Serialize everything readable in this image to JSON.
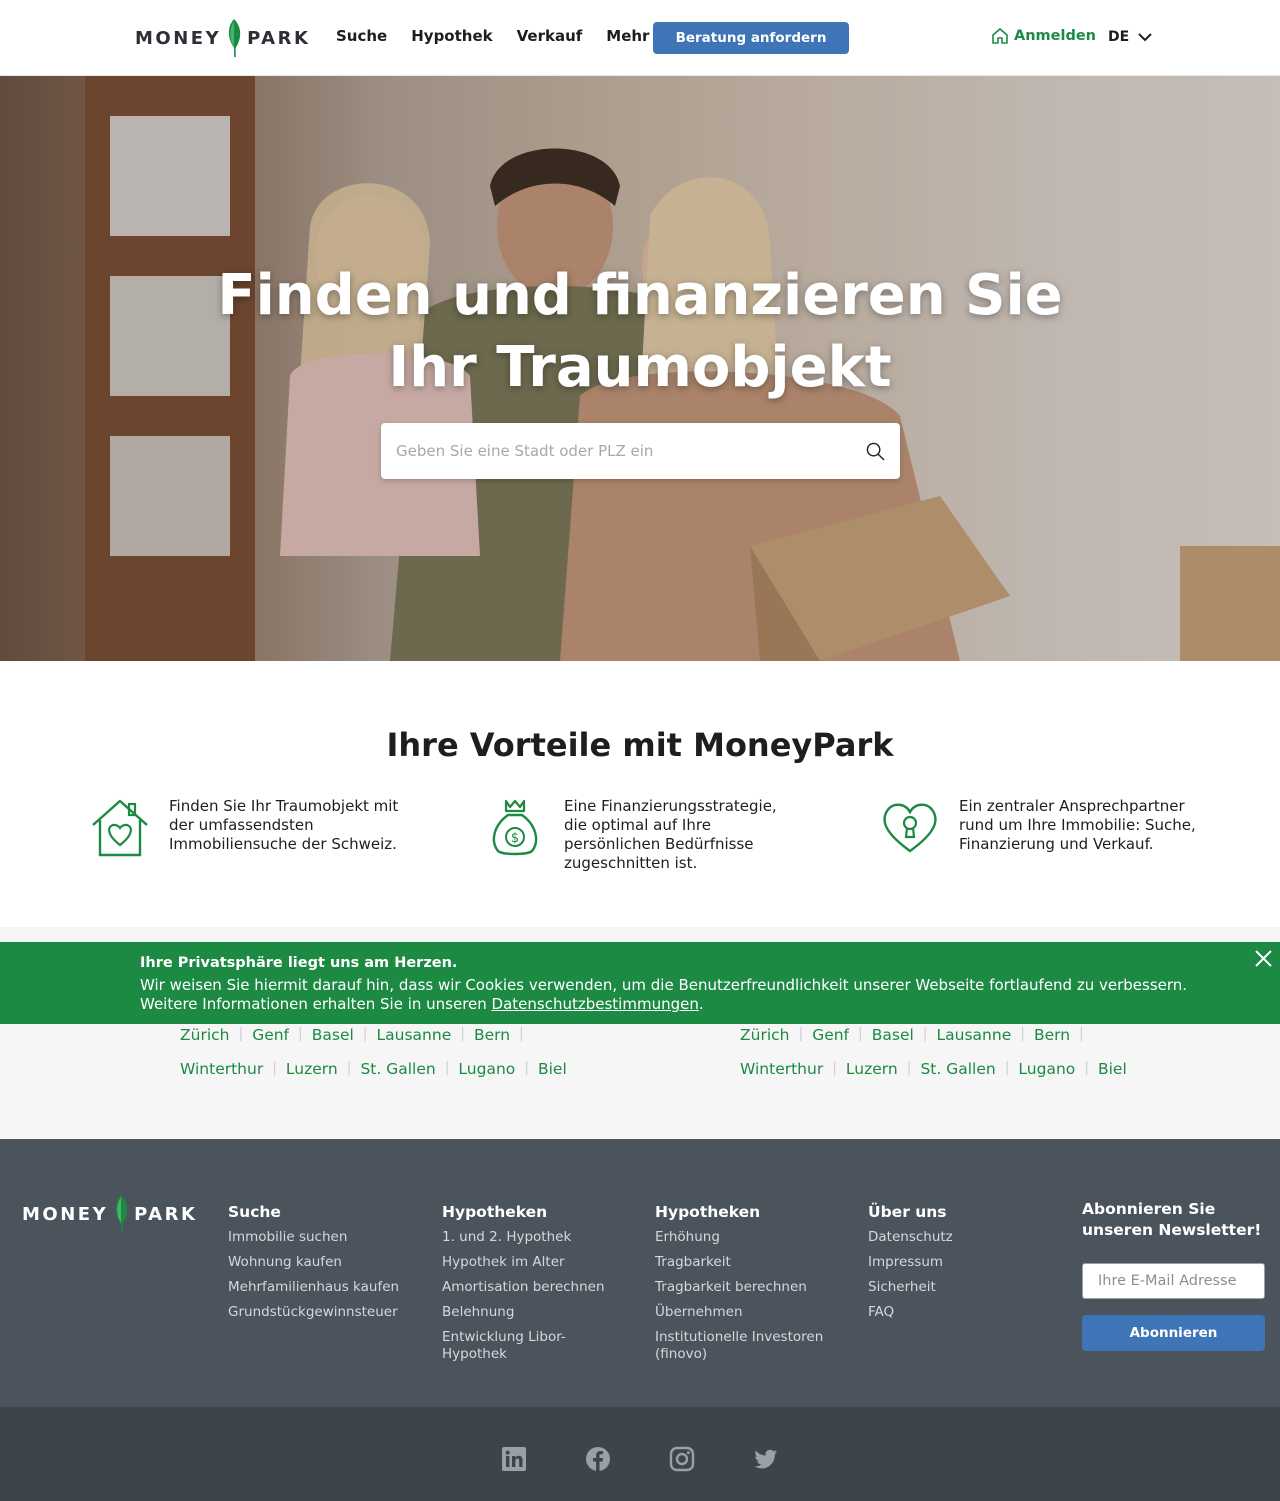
{
  "brand": {
    "left": "MONEY",
    "right": "PARK",
    "leaf_color": "#1c8a43"
  },
  "header": {
    "nav": [
      "Suche",
      "Hypothek",
      "Verkauf",
      "Mehr"
    ],
    "cta_label": "Beratung anfordern",
    "login_label": "Anmelden",
    "lang": "DE"
  },
  "hero": {
    "title_line1": "Finden und finanzieren Sie",
    "title_line2": "Ihr Traumobjekt",
    "search_placeholder": "Geben Sie eine Stadt oder PLZ ein"
  },
  "advantages": {
    "title": "Ihre Vorteile mit MoneyPark",
    "items": [
      {
        "icon": "house-heart-icon",
        "text": "Finden Sie Ihr Traumobjekt mit der umfassendsten Immobiliensuche der Schweiz."
      },
      {
        "icon": "money-bag-icon",
        "text": "Eine Finanzierungsstrategie, die optimal auf Ihre persönlichen Bedürfnisse zugeschnitten ist."
      },
      {
        "icon": "heart-keyhole-icon",
        "text": "Ein zentraler Ansprechpartner rund um Ihre Immobilie: Suche, Finanzierung und Verkauf."
      }
    ]
  },
  "cities": {
    "row1": [
      "Zürich",
      "Genf",
      "Basel",
      "Lausanne",
      "Bern"
    ],
    "row2": [
      "Winterthur",
      "Luzern",
      "St. Gallen",
      "Lugano",
      "Biel"
    ]
  },
  "cookie": {
    "title": "Ihre Privatsphäre liegt uns am Herzen.",
    "line1": "Wir weisen Sie hiermit darauf hin, dass wir Cookies verwenden, um die Benutzerfreundlichkeit unserer Webseite fortlaufend zu verbessern.",
    "line2_prefix": "Weitere Informationen erhalten Sie in unseren ",
    "link": "Datenschutzbestimmungen",
    "line2_suffix": "."
  },
  "footer": {
    "col1": {
      "title": "Suche",
      "links": [
        "Immobilie suchen",
        "Wohnung kaufen",
        "Mehrfamilienhaus kaufen",
        "Grundstückgewinnsteuer"
      ]
    },
    "col2": {
      "title": "Hypotheken",
      "links": [
        "1. und 2. Hypothek",
        "Hypothek im Alter",
        "Amortisation berechnen",
        "Belehnung",
        "Entwicklung Libor-Hypothek"
      ]
    },
    "col3": {
      "title": "Hypotheken",
      "links": [
        "Erhöhung",
        "Tragbarkeit",
        "Tragbarkeit berechnen",
        "Übernehmen",
        "Institutionelle Investoren (finovo)"
      ]
    },
    "col4": {
      "title": "Über uns",
      "links": [
        "Datenschutz",
        "Impressum",
        "Sicherheit",
        "FAQ"
      ]
    },
    "newsletter": {
      "title": "Abonnieren Sie unseren Newsletter!",
      "placeholder": "Ihre E-Mail Adresse",
      "button": "Abonnieren"
    }
  },
  "social": [
    "linkedin-icon",
    "facebook-icon",
    "instagram-icon",
    "twitter-icon"
  ]
}
